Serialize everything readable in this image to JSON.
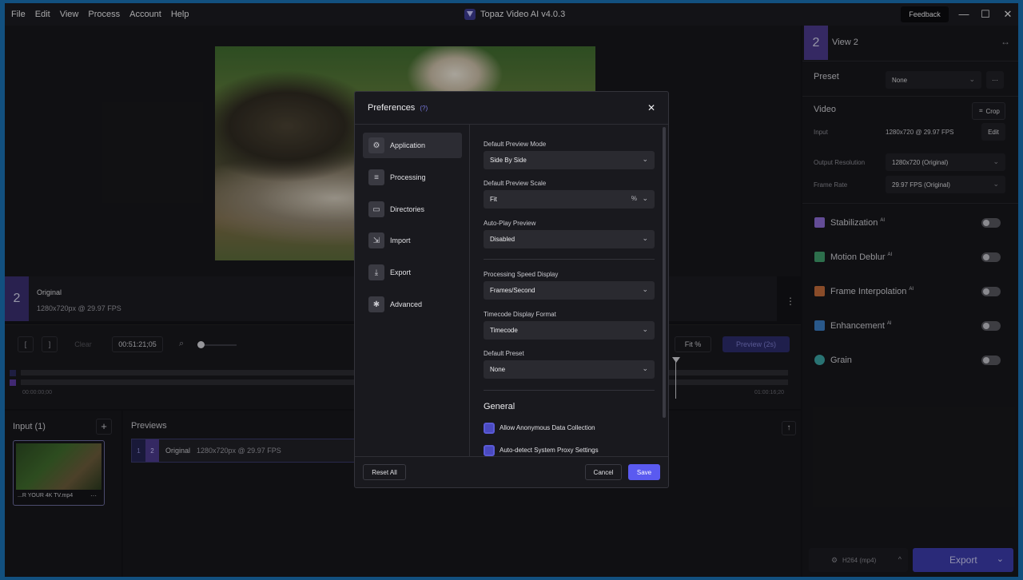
{
  "window": {
    "title": "Topaz Video AI  v4.0.3",
    "menus": [
      "File",
      "Edit",
      "View",
      "Process",
      "Account",
      "Help"
    ],
    "feedback_label": "Feedback",
    "minimize": "—",
    "maximize": "☐",
    "close": "✕"
  },
  "preview": {
    "view_number": "2",
    "clip_title": "Original",
    "clip_info": "1280x720px @ 29.97 FPS",
    "more": "⋮"
  },
  "timeline": {
    "bracket_in": "[",
    "bracket_out": "]",
    "clear_label": "Clear",
    "timecode": "00:51:21;05",
    "fit_label": "Fit %",
    "preview_button": "Preview (2s)",
    "start_time": "00:00:00;00",
    "end_time": "01:00:16;20"
  },
  "input_panel": {
    "title": "Input (1)",
    "add": "+",
    "thumb_name": "...R YOUR 4K TV.mp4",
    "thumb_more": "···"
  },
  "previews_panel": {
    "title": "Previews",
    "row_num1": "1",
    "row_num2": "2",
    "row_title": "Original",
    "row_info": "1280x720px @ 29.97 FPS",
    "export_arrow": "↑"
  },
  "right_panel": {
    "view_number": "2",
    "view_title": "View 2",
    "expand_icon": "↔",
    "preset_label": "Preset",
    "preset_value": "None",
    "preset_more": "···",
    "video_label": "Video",
    "crop_label": "Crop",
    "input_label": "Input",
    "input_value": "1280x720 @ 29.97 FPS",
    "edit_label": "Edit",
    "output_res_label": "Output Resolution",
    "output_res_value": "1280x720 (Original)",
    "frame_rate_label": "Frame Rate",
    "frame_rate_value": "29.97 FPS (Original)",
    "enhancements": [
      {
        "label": "Stabilization",
        "sup": "AI",
        "color": "#8a6ad0"
      },
      {
        "label": "Motion Deblur",
        "sup": "AI",
        "color": "#3f9a6a"
      },
      {
        "label": "Frame Interpolation",
        "sup": "AI",
        "color": "#c06a3a"
      },
      {
        "label": "Enhancement",
        "sup": "AI",
        "color": "#3a7ac0"
      },
      {
        "label": "Grain",
        "sup": "",
        "color": "#3aa0a0"
      }
    ],
    "codec_label": "H264 (mp4)",
    "export_label": "Export"
  },
  "dialog": {
    "title": "Preferences",
    "help": "(?)",
    "close": "✕",
    "nav": [
      {
        "label": "Application",
        "icon": "⚙"
      },
      {
        "label": "Processing",
        "icon": "≡"
      },
      {
        "label": "Directories",
        "icon": "▭"
      },
      {
        "label": "Import",
        "icon": "⇲"
      },
      {
        "label": "Export",
        "icon": "⤓"
      },
      {
        "label": "Advanced",
        "icon": "✱"
      }
    ],
    "fields": [
      {
        "label": "Default Preview Mode",
        "value": "Side By Side",
        "suffix": ""
      },
      {
        "label": "Default Preview Scale",
        "value": "Fit",
        "suffix": "%"
      },
      {
        "label": "Auto-Play Preview",
        "value": "Disabled",
        "suffix": ""
      },
      {
        "label": "Processing Speed Display",
        "value": "Frames/Second",
        "suffix": ""
      },
      {
        "label": "Timecode Display Format",
        "value": "Timecode",
        "suffix": ""
      },
      {
        "label": "Default Preset",
        "value": "None",
        "suffix": ""
      }
    ],
    "general_title": "General",
    "checkboxes": [
      "Allow Anonymous Data Collection",
      "Auto-detect System Proxy Settings"
    ],
    "reset_all": "Reset All",
    "cancel": "Cancel",
    "save": "Save"
  }
}
